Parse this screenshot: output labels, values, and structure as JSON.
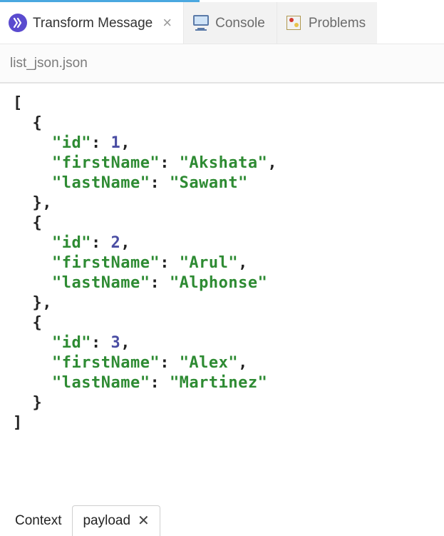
{
  "tabs": {
    "transform": {
      "label": "Transform Message"
    },
    "console": {
      "label": "Console"
    },
    "problems": {
      "label": "Problems"
    }
  },
  "file": {
    "name": "list_json.json"
  },
  "json": {
    "records": [
      {
        "id": 1,
        "firstName": "Akshata",
        "lastName": "Sawant"
      },
      {
        "id": 2,
        "firstName": "Arul",
        "lastName": "Alphonse"
      },
      {
        "id": 3,
        "firstName": "Alex",
        "lastName": "Martinez"
      }
    ],
    "keys": {
      "id": "id",
      "firstName": "firstName",
      "lastName": "lastName"
    }
  },
  "bottomTabs": {
    "context": {
      "label": "Context"
    },
    "payload": {
      "label": "payload"
    }
  }
}
